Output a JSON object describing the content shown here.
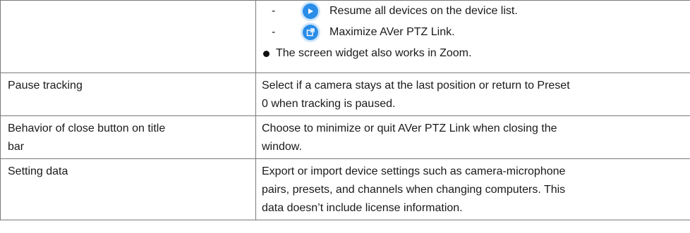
{
  "rows": [
    {
      "name": "",
      "items": [
        {
          "kind": "dash",
          "icon": "play-icon",
          "text": "Resume all devices on the device list."
        },
        {
          "kind": "dash",
          "icon": "maximize-icon",
          "text": "Maximize AVer PTZ Link."
        },
        {
          "kind": "bullet",
          "text": "The screen widget also works in Zoom."
        }
      ]
    },
    {
      "name": "Pause tracking",
      "description_lines": [
        "Select if a camera stays at the last position or return to Preset",
        "0 when tracking is paused."
      ]
    },
    {
      "name_lines": [
        "Behavior of close button on title",
        "bar"
      ],
      "description_lines": [
        "Choose to minimize or quit AVer PTZ Link when closing the",
        "window."
      ]
    },
    {
      "name": "Setting data",
      "description_lines": [
        "Export or import device settings such as camera-microphone",
        "pairs, presets, and channels when changing computers. This",
        "data doesn’t include license information."
      ]
    }
  ],
  "dash_symbol": "-",
  "colors": {
    "icon_blue": "#2a8de8",
    "border": "#7a7a7a",
    "text": "#1a1a1a"
  }
}
